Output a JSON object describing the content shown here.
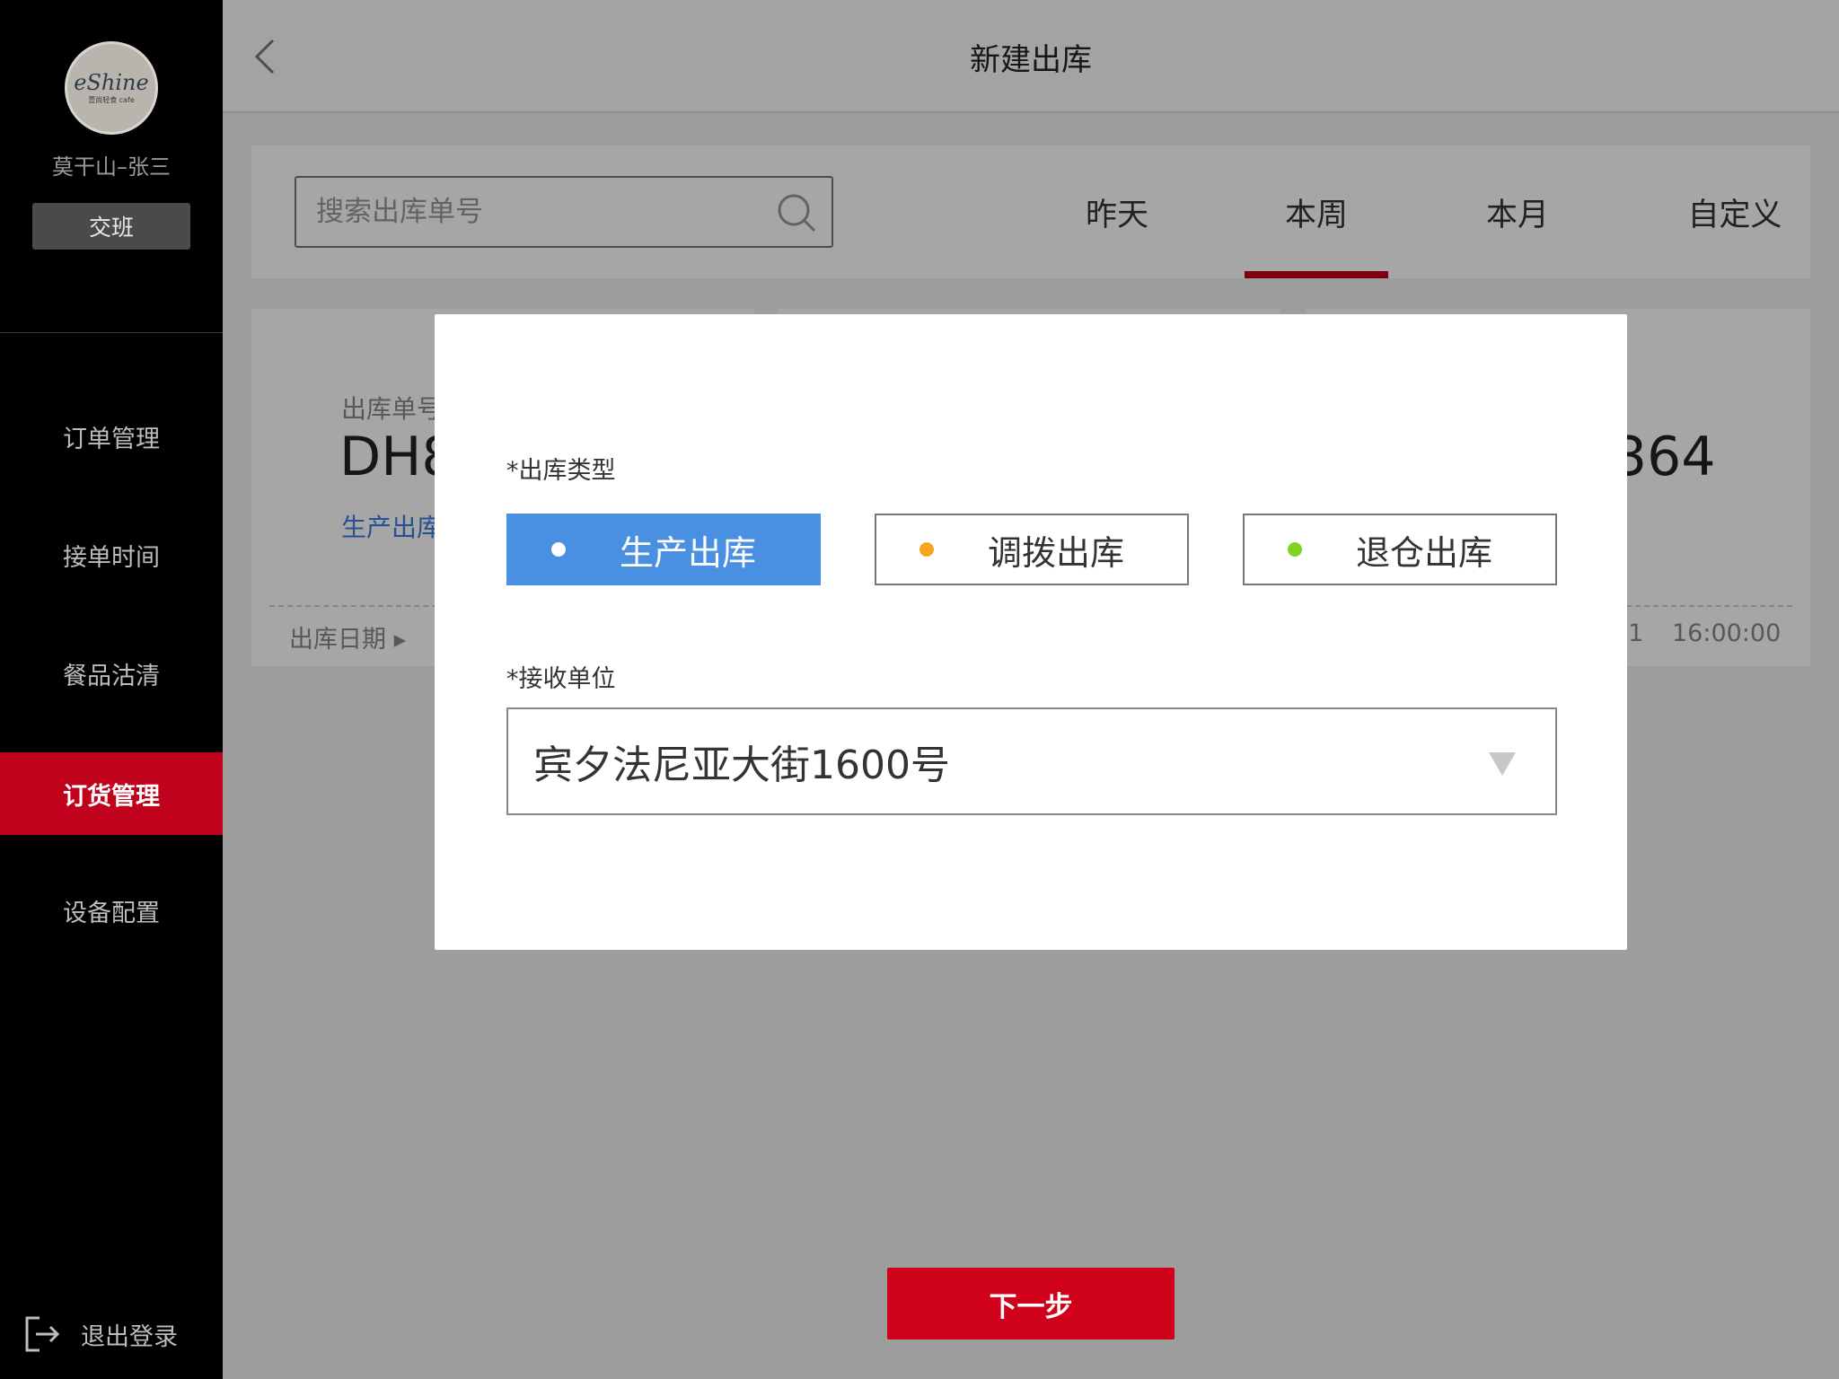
{
  "sidebar": {
    "logo_text": "eShine",
    "logo_subtext": "壹尚轻食 cafe",
    "user_name": "莫干山–张三",
    "shift_label": "交班",
    "nav": [
      {
        "label": "订单管理",
        "active": false
      },
      {
        "label": "接单时间",
        "active": false
      },
      {
        "label": "餐品沽清",
        "active": false
      },
      {
        "label": "订货管理",
        "active": true
      },
      {
        "label": "设备配置",
        "active": false
      }
    ],
    "logout_label": "退出登录"
  },
  "header": {
    "title": "新建出库"
  },
  "filter": {
    "search_placeholder": "搜索出库单号",
    "tabs": [
      "昨天",
      "本周",
      "本月",
      "自定义"
    ],
    "active_tab": "本周"
  },
  "cards": [
    {
      "label": "出库单号",
      "code_partial": "DH8",
      "type": "生产出库",
      "date_label": "出库日期 ▸"
    },
    {
      "code_partial": "364",
      "date_partial": "01",
      "time": "16:00:00"
    }
  ],
  "modal": {
    "type_label": "*出库类型",
    "types": [
      {
        "label": "生产出库",
        "dot_color": "#ffffff",
        "selected": true
      },
      {
        "label": "调拨出库",
        "dot_color": "#f5a623",
        "selected": false
      },
      {
        "label": "退仓出库",
        "dot_color": "#7ed321",
        "selected": false
      }
    ],
    "receiver_label": "*接收单位",
    "receiver_value": "宾夕法尼亚大街1600号"
  },
  "footer": {
    "next_label": "下一步"
  },
  "colors": {
    "accent_red": "#c0021c",
    "selected_blue": "#4a90e2"
  }
}
